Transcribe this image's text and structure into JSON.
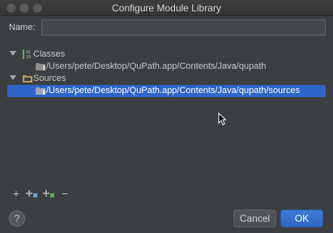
{
  "window": {
    "title": "Configure Module Library"
  },
  "name_field": {
    "label": "Name:",
    "value": ""
  },
  "tree": {
    "classes_label": "Classes",
    "classes_path": "/Users/pete/Desktop/QuPath.app/Contents/Java/qupath",
    "sources_label": "Sources",
    "sources_path": "/Users/pete/Desktop/QuPath.app/Contents/Java/qupath/sources"
  },
  "toolbar": {
    "add": "+",
    "remove": "−"
  },
  "buttons": {
    "help": "?",
    "cancel": "Cancel",
    "ok": "OK"
  },
  "colors": {
    "selection": "#2f65ca",
    "accent": "#3d7bd8"
  }
}
